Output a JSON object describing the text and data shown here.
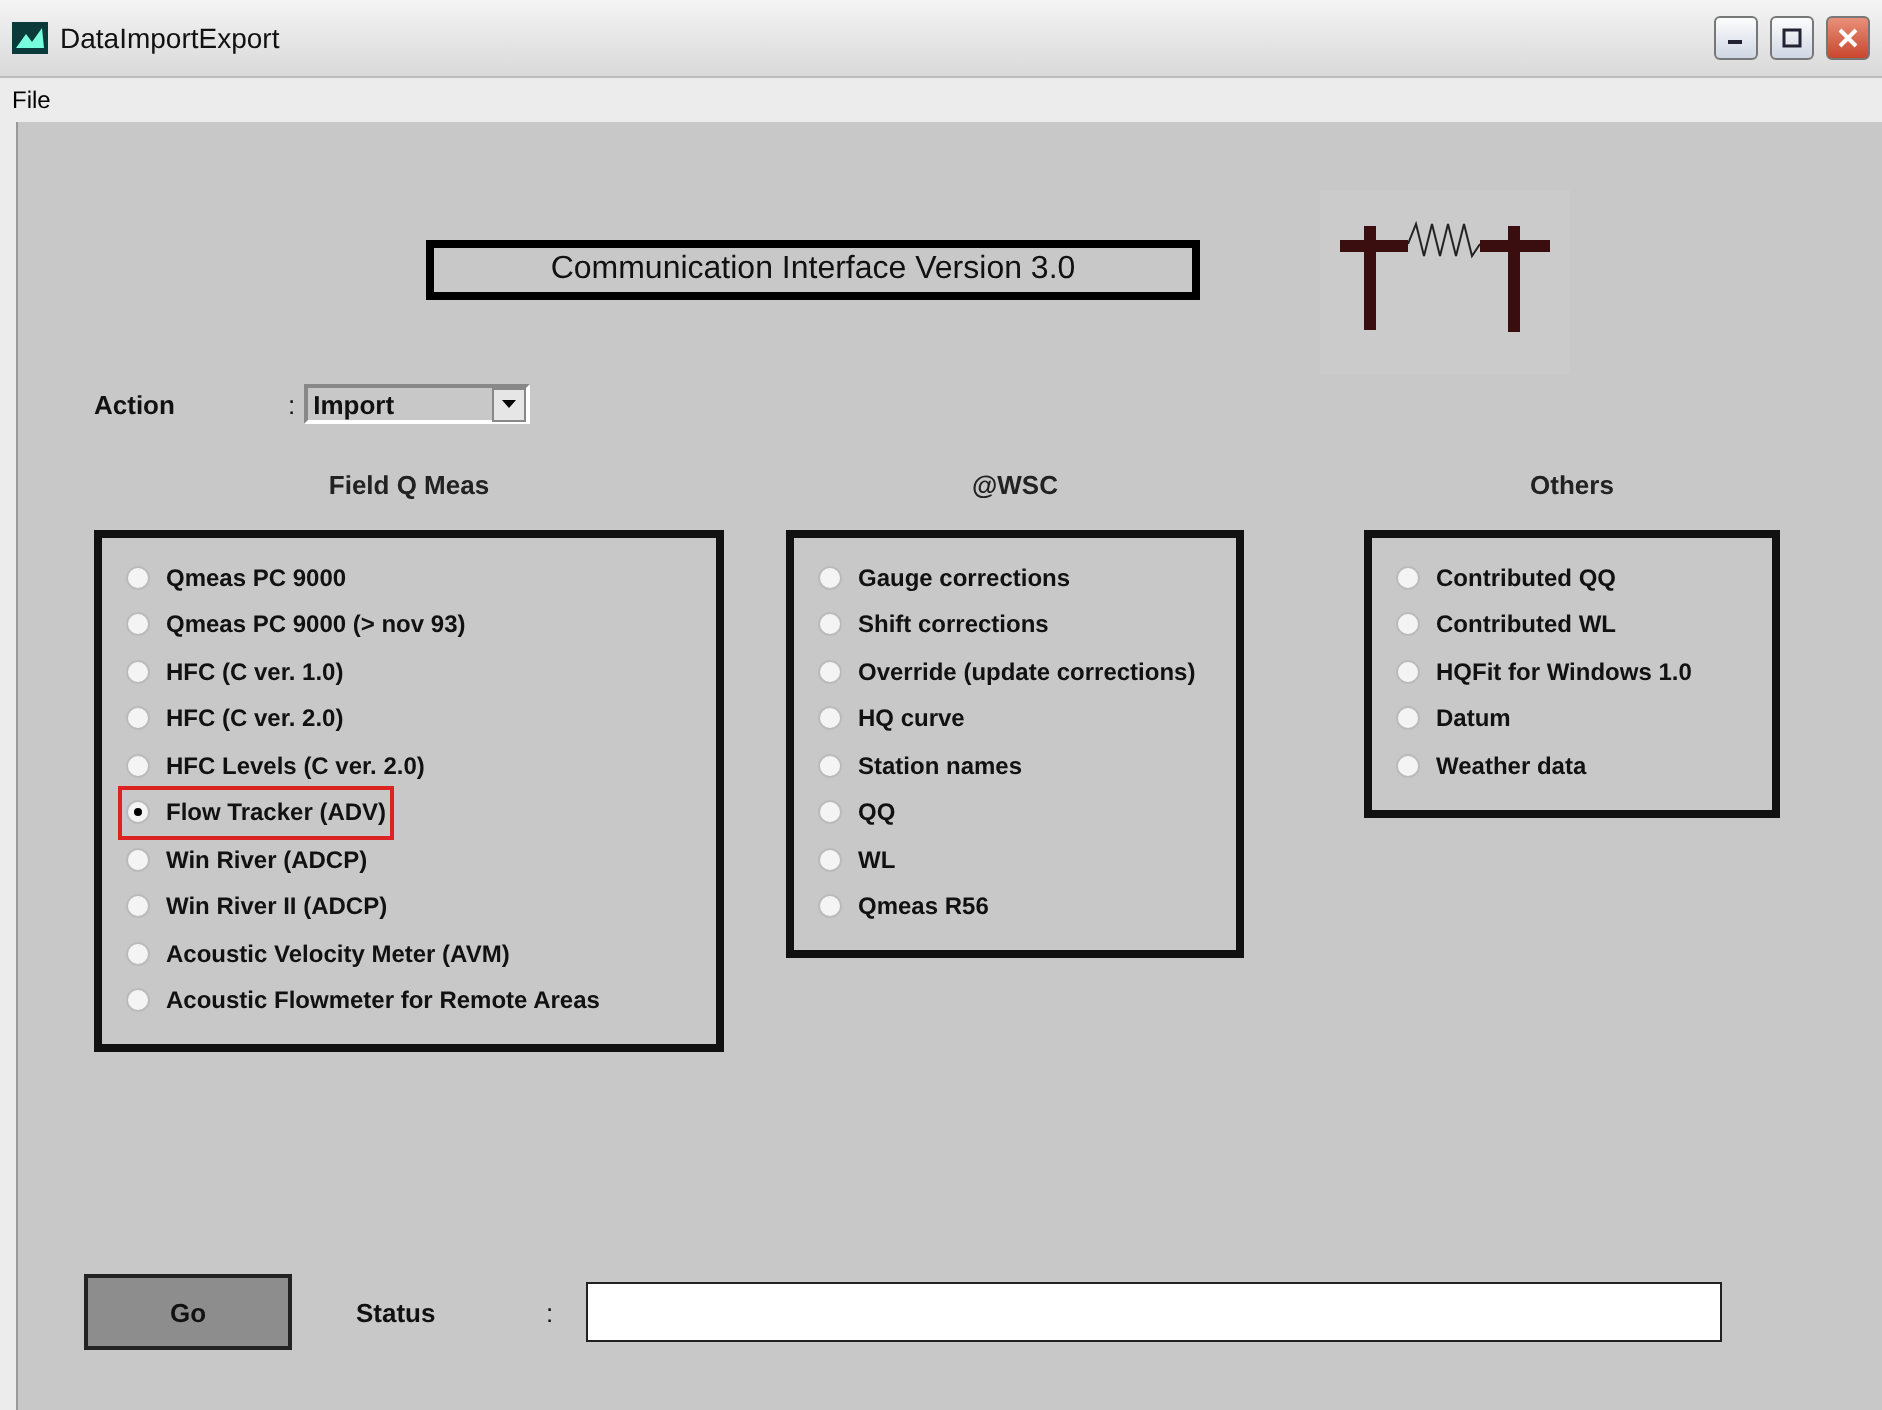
{
  "window": {
    "title": "DataImportExport"
  },
  "menu": [
    "File"
  ],
  "banner": {
    "title": "Communication Interface Version 3.0"
  },
  "action": {
    "label": "Action",
    "separator": ":",
    "value": "Import"
  },
  "groups": [
    {
      "heading": "Field Q Meas",
      "options": [
        {
          "label": "Qmeas PC 9000",
          "selected": false
        },
        {
          "label": "Qmeas PC 9000 (> nov 93)",
          "selected": false
        },
        {
          "label": "HFC (C ver. 1.0)",
          "selected": false
        },
        {
          "label": "HFC (C ver. 2.0)",
          "selected": false
        },
        {
          "label": "HFC Levels (C ver. 2.0)",
          "selected": false
        },
        {
          "label": "Flow Tracker (ADV)",
          "selected": true
        },
        {
          "label": "Win River (ADCP)",
          "selected": false
        },
        {
          "label": "Win River II (ADCP)",
          "selected": false
        },
        {
          "label": "Acoustic Velocity Meter (AVM)",
          "selected": false
        },
        {
          "label": "Acoustic Flowmeter for Remote Areas",
          "selected": false
        }
      ]
    },
    {
      "heading": "@WSC",
      "options": [
        {
          "label": "Gauge corrections",
          "selected": false
        },
        {
          "label": "Shift corrections",
          "selected": false
        },
        {
          "label": "Override (update corrections)",
          "selected": false
        },
        {
          "label": "HQ curve",
          "selected": false
        },
        {
          "label": "Station names",
          "selected": false
        },
        {
          "label": "QQ",
          "selected": false
        },
        {
          "label": "WL",
          "selected": false
        },
        {
          "label": "Qmeas R56",
          "selected": false
        }
      ]
    },
    {
      "heading": "Others",
      "options": [
        {
          "label": "Contributed QQ",
          "selected": false
        },
        {
          "label": "Contributed WL",
          "selected": false
        },
        {
          "label": "HQFit for Windows 1.0",
          "selected": false
        },
        {
          "label": "Datum",
          "selected": false
        },
        {
          "label": "Weather data",
          "selected": false
        }
      ]
    }
  ],
  "go_button": "Go",
  "status": {
    "label": "Status",
    "separator": ":"
  }
}
